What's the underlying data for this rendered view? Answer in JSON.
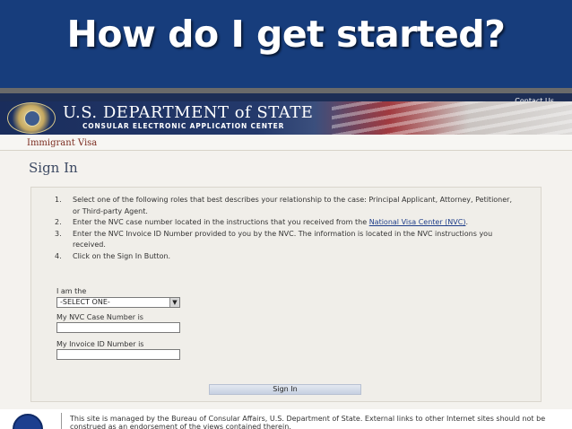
{
  "slide": {
    "title": "How do I get started?"
  },
  "header": {
    "contact_link": "Contact Us",
    "department": "U.S. DEPARTMENT of STATE",
    "subtitle": "CONSULAR ELECTRONIC APPLICATION CENTER"
  },
  "breadcrumb": "Immigrant Visa",
  "page_title": "Sign In",
  "instructions": [
    {
      "num": "1.",
      "text": "Select one of the following roles that best describes your relationship to the case: Principal Applicant, Attorney, Petitioner, or Third-party Agent."
    },
    {
      "num": "2.",
      "text_before": "Enter the NVC case number located in the instructions that you received from the ",
      "link": "National Visa Center (NVC)",
      "text_after": "."
    },
    {
      "num": "3.",
      "text": "Enter the NVC Invoice ID Number provided to you by the NVC. The information is located in the NVC instructions you received."
    },
    {
      "num": "4.",
      "text": "Click on the Sign In Button."
    }
  ],
  "form": {
    "role_label": "I am the",
    "role_value": "-SELECT ONE-",
    "case_label": "My NVC Case Number is",
    "case_value": "",
    "invoice_label": "My Invoice ID Number is",
    "invoice_value": "",
    "signin_label": "Sign In"
  },
  "footer": {
    "text": "This site is managed by the Bureau of Consular Affairs, U.S. Department of State. External links to other Internet sites should not be construed as an endorsement of the views contained therein."
  },
  "colors": {
    "title_band": "#173d7c",
    "banner_navy": "#1a2d5c",
    "breadcrumb_text": "#7a2a1e",
    "link": "#1f3e8a"
  }
}
